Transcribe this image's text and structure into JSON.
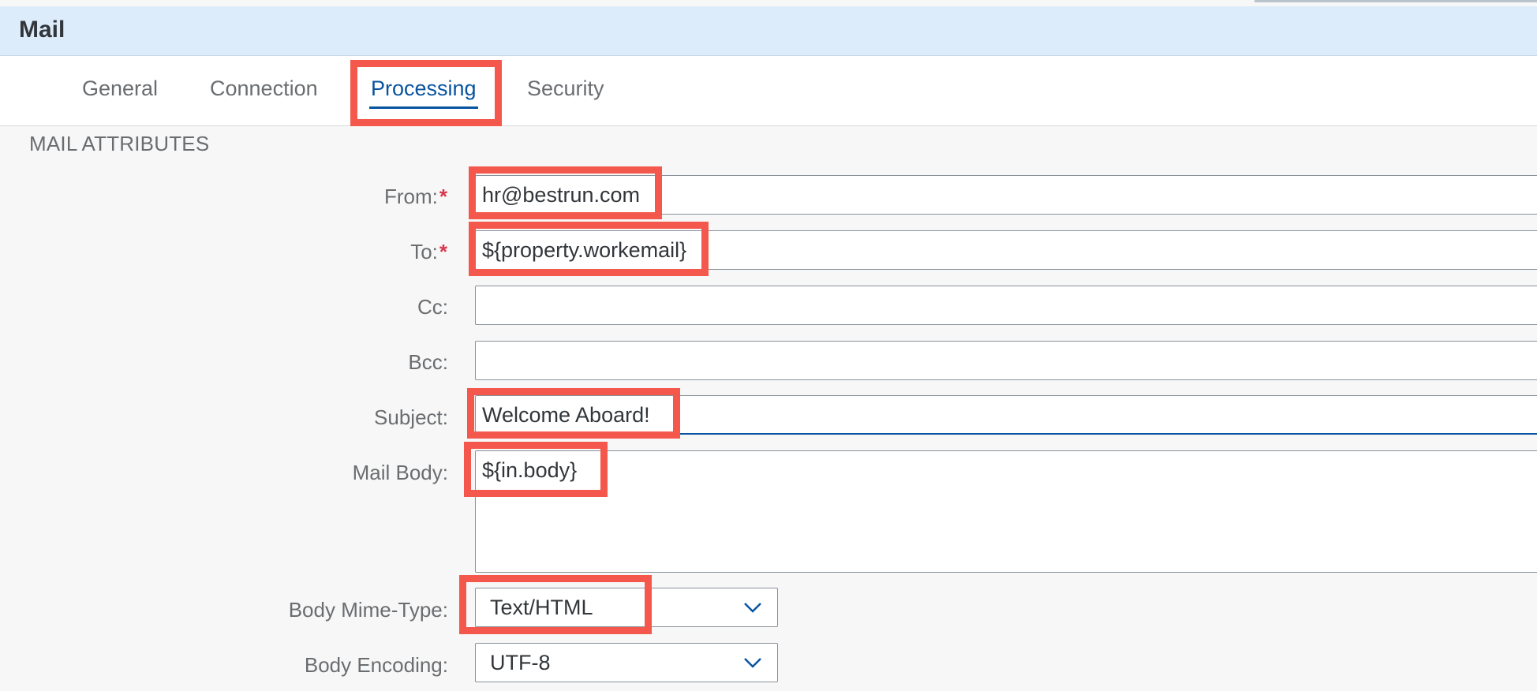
{
  "header": {
    "title": "Mail"
  },
  "tabs": [
    {
      "label": "General"
    },
    {
      "label": "Connection"
    },
    {
      "label": "Processing",
      "selected": true
    },
    {
      "label": "Security"
    }
  ],
  "section": {
    "title": "MAIL ATTRIBUTES"
  },
  "fields": {
    "from": {
      "label": "From:",
      "required": true,
      "value": "hr@bestrun.com"
    },
    "to": {
      "label": "To:",
      "required": true,
      "value": "${property.workemail}"
    },
    "cc": {
      "label": "Cc:",
      "value": ""
    },
    "bcc": {
      "label": "Bcc:",
      "value": ""
    },
    "subject": {
      "label": "Subject:",
      "value": "Welcome Aboard!"
    },
    "mail_body": {
      "label": "Mail Body:",
      "value": "${in.body}"
    },
    "body_mime_type": {
      "label": "Body Mime-Type:",
      "value": "Text/HTML"
    },
    "body_encoding": {
      "label": "Body Encoding:",
      "value": "UTF-8"
    }
  },
  "required_marker": "*",
  "colors": {
    "header_bg": "#dcecfb",
    "accent": "#0854a0",
    "highlight": "#f4584c",
    "required": "#d9364c"
  }
}
